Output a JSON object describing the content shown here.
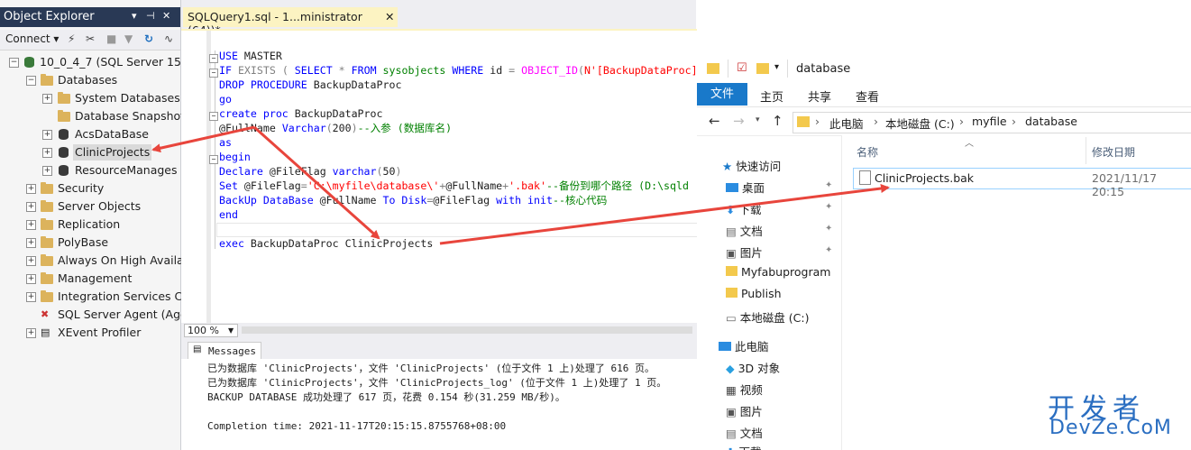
{
  "object_explorer": {
    "title": "Object Explorer",
    "pin": "▾ ᛫ ✕",
    "toolbar": {
      "connect": "Connect ▾"
    },
    "tree": {
      "server": "10_0_4_7 (SQL Server 15.0",
      "databases": "Databases",
      "system_databases": "System Databases",
      "database_snapshots": "Database Snapshot",
      "acs_database": "AcsDataBase",
      "clinic_projects": "ClinicProjects",
      "resource_manages": "ResourceManages",
      "security": "Security",
      "server_objects": "Server Objects",
      "replication": "Replication",
      "polybase": "PolyBase",
      "always_on": "Always On High Availal",
      "management": "Management",
      "integration_services": "Integration Services Ca",
      "sql_server_agent": "SQL Server Agent (Age",
      "xevent_profiler": "XEvent Profiler"
    }
  },
  "editor": {
    "tab_title": "SQLQuery1.sql - 1...ministrator (64))*",
    "tab_close": "✕",
    "zoom": "100 %",
    "messages_tab": "Messages"
  },
  "messages": {
    "line1": "已为数据库 'ClinicProjects'，文件 'ClinicProjects' (位于文件 1 上)处理了 616 页。",
    "line2": "已为数据库 'ClinicProjects'，文件 'ClinicProjects_log' (位于文件 1 上)处理了 1 页。",
    "line3": "BACKUP DATABASE 成功处理了 617 页，花费 0.154 秒(31.259 MB/秒)。",
    "line4": "Completion time: 2021-11-17T20:15:15.8755768+08:00"
  },
  "file_explorer": {
    "window_title": "database",
    "ribbon": {
      "file": "文件",
      "home": "主页",
      "share": "共享",
      "view": "查看"
    },
    "breadcrumb": [
      "此电脑",
      "本地磁盘 (C:)",
      "myfile",
      "database"
    ],
    "columns": {
      "name": "名称",
      "modified": "修改日期"
    },
    "nav": {
      "quick_access": "快速访问",
      "desktop": "桌面",
      "downloads": "下载",
      "documents": "文档",
      "pictures": "图片",
      "myfabuprogram": "Myfabuprogram",
      "publish": "Publish",
      "local_disk": "本地磁盘 (C:)",
      "this_pc": "此电脑",
      "objects_3d": "3D 对象",
      "videos": "视频",
      "pictures2": "图片",
      "documents2": "文档",
      "downloads2": "下载"
    },
    "file": {
      "name": "ClinicProjects.bak",
      "modified": "2021/11/17 20:15"
    }
  },
  "watermark": {
    "line1": "开发者",
    "line2": "DevZe.CoM"
  },
  "colors": {
    "oe_title": "#293955",
    "tab_active": "#fcf3c2",
    "ribbon_file": "#1979ca",
    "arrow": "#e8453c"
  }
}
